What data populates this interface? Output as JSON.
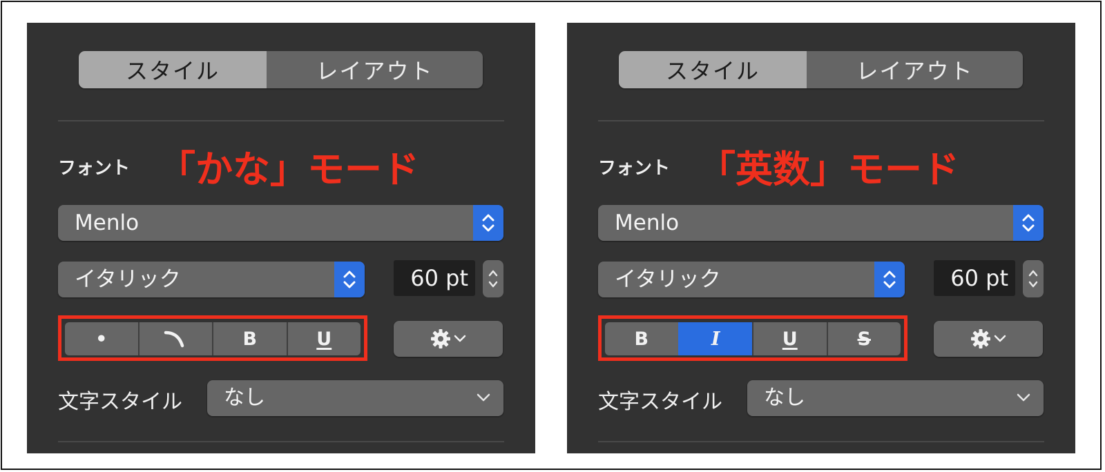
{
  "panels": [
    {
      "tabs": {
        "style": "スタイル",
        "layout": "レイアウト"
      },
      "font_label": "フォント",
      "mode_note": "「かな」モード",
      "font_family": "Menlo",
      "font_style": "イタリック",
      "font_size": "60 pt",
      "format_buttons": [
        "•",
        "",
        "B",
        "U"
      ],
      "char_style_label": "文字スタイル",
      "char_style_value": "なし"
    },
    {
      "tabs": {
        "style": "スタイル",
        "layout": "レイアウト"
      },
      "font_label": "フォント",
      "mode_note": "「英数」モード",
      "font_family": "Menlo",
      "font_style": "イタリック",
      "font_size": "60 pt",
      "format_buttons": [
        "B",
        "I",
        "U",
        "S"
      ],
      "char_style_label": "文字スタイル",
      "char_style_value": "なし"
    }
  ],
  "colors": {
    "panel_bg": "#323232",
    "highlight": "#f02f1d",
    "accent_blue": "#2a6de0"
  },
  "icons": [
    "up-down-stepper-icon",
    "gear-icon",
    "chevron-down-icon",
    "curve-mark-icon"
  ]
}
